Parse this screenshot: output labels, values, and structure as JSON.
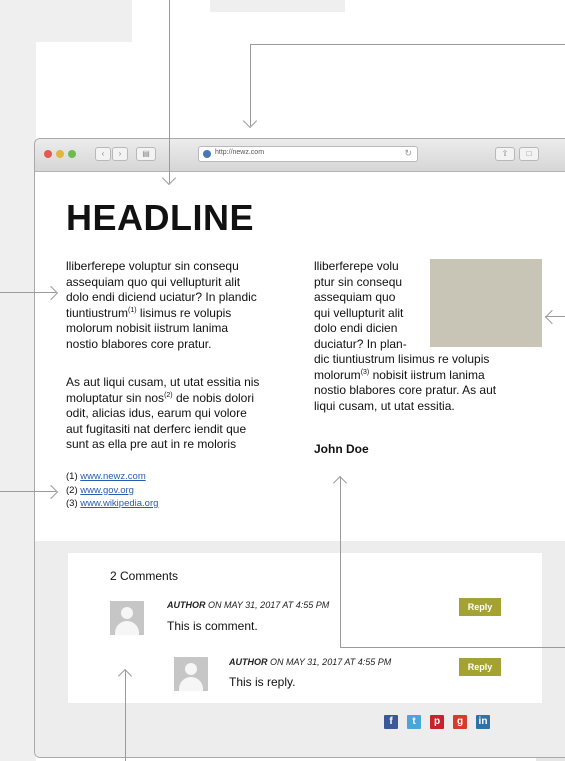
{
  "browser": {
    "url": "http://newz.com",
    "tab_icons": [
      "back-icon",
      "forward-icon",
      "sidebar-icon",
      "share-icon",
      "new-tab-icon"
    ]
  },
  "article": {
    "headline": "HEADLINE",
    "col1_p1": [
      "lliberferepe voluptur sin consequ",
      "assequiam quo qui vellupturit alit",
      "dolo endi diciend uciatur? In plandic",
      "tiuntiustrum",
      "(1)",
      " lisimus re volupis",
      "molorum nobisit iistrum lanima",
      "nostio blabores core pratur."
    ],
    "col1_p2": [
      "As aut liqui cusam, ut utat essitia nis",
      "moluptatur sin nos",
      "(2)",
      " de nobis dolori",
      "odit, alicias idus, earum qui volore",
      "aut fugitasiti nat derferc iendit que",
      "sunt as ella pre aut in re moloris"
    ],
    "col2_p": [
      "lliberferepe volu",
      "ptur sin consequ",
      "assequiam quo",
      "qui vellupturit alit",
      "dolo endi dicien",
      "duciatur? In plan-",
      "dic tiuntiustrum lisimus re volupis",
      "molorum",
      "(3)",
      " nobisit iistrum lanima",
      "nostio blabores core pratur. As aut",
      "liqui cusam, ut utat essitia."
    ],
    "author": "John Doe",
    "refs": [
      {
        "num": "(1)",
        "link": "www.newz.com"
      },
      {
        "num": "(2)",
        "link": "www.gov.org"
      },
      {
        "num": "(3)",
        "link": "www.wikipedia.org"
      }
    ]
  },
  "comments": {
    "count_label": "2 Comments",
    "items": [
      {
        "author": "AUTHOR",
        "date": " ON MAY 31, 2017 AT 4:55 PM",
        "text": "This is comment.",
        "reply_label": "Reply"
      },
      {
        "author": "AUTHOR",
        "date": " ON MAY 31, 2017 AT 4:55 PM",
        "text": "This is reply.",
        "reply_label": "Reply"
      }
    ]
  },
  "social": [
    {
      "name": "facebook-icon",
      "glyph": "f",
      "color": "#3b5998"
    },
    {
      "name": "twitter-icon",
      "glyph": "t",
      "color": "#4aa5d8"
    },
    {
      "name": "pinterest-icon",
      "glyph": "p",
      "color": "#c8232c"
    },
    {
      "name": "google-plus-icon",
      "glyph": "g",
      "color": "#d23e2b"
    },
    {
      "name": "linkedin-icon",
      "glyph": "in",
      "color": "#2e72a8"
    }
  ]
}
